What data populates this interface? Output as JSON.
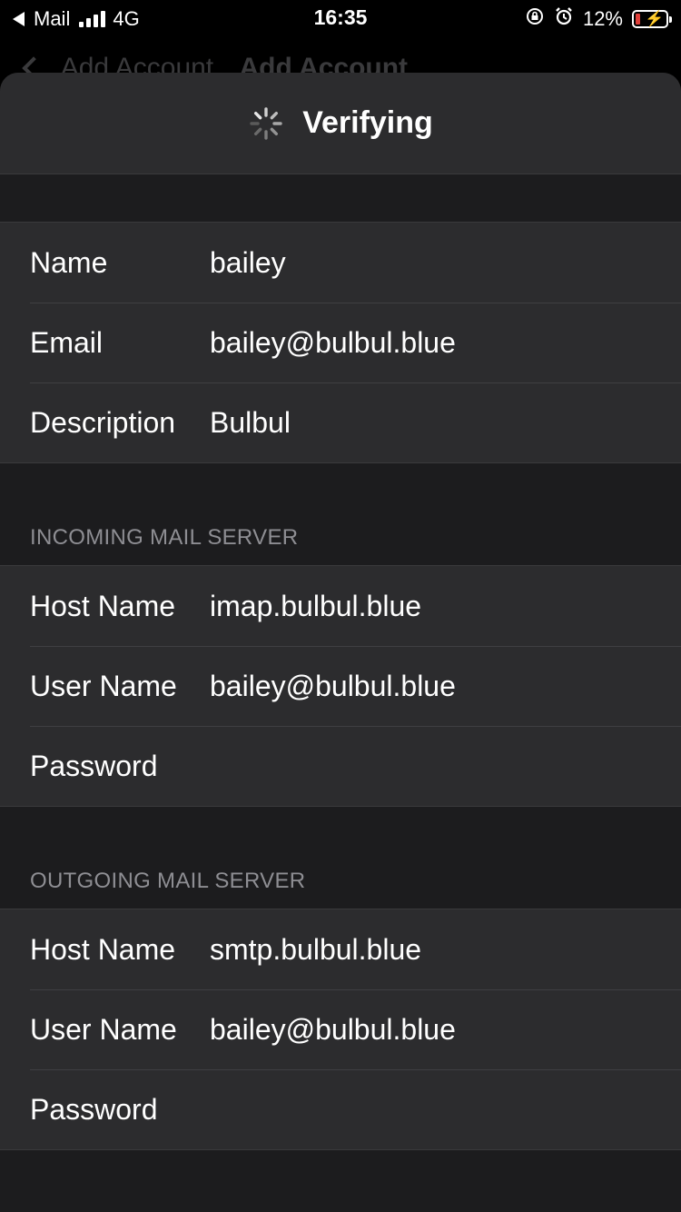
{
  "status_bar": {
    "back_app": "Mail",
    "network": "4G",
    "time": "16:35",
    "battery": "12%"
  },
  "background_nav": {
    "back_label": "Add Account",
    "title": "Add Account"
  },
  "sheet": {
    "title": "Verifying"
  },
  "account": {
    "rows": [
      {
        "label": "Name",
        "value": "bailey"
      },
      {
        "label": "Email",
        "value": "bailey@bulbul.blue"
      },
      {
        "label": "Description",
        "value": "Bulbul"
      }
    ]
  },
  "incoming": {
    "header": "INCOMING MAIL SERVER",
    "rows": [
      {
        "label": "Host Name",
        "value": "imap.bulbul.blue"
      },
      {
        "label": "User Name",
        "value": "bailey@bulbul.blue"
      },
      {
        "label": "Password",
        "value": ""
      }
    ]
  },
  "outgoing": {
    "header": "OUTGOING MAIL SERVER",
    "rows": [
      {
        "label": "Host Name",
        "value": "smtp.bulbul.blue"
      },
      {
        "label": "User Name",
        "value": "bailey@bulbul.blue"
      },
      {
        "label": "Password",
        "value": ""
      }
    ]
  },
  "icons": {
    "signal": "cellular-signal-icon",
    "rotation_lock": "rotation-lock-icon",
    "alarm": "alarm-icon",
    "battery": "battery-charging-icon",
    "spinner": "activity-spinner-icon"
  },
  "colors": {
    "background": "#1c1c1e",
    "cell": "#2c2c2e",
    "section_header_text": "#8e8e93",
    "battery_low": "#e0403a"
  }
}
